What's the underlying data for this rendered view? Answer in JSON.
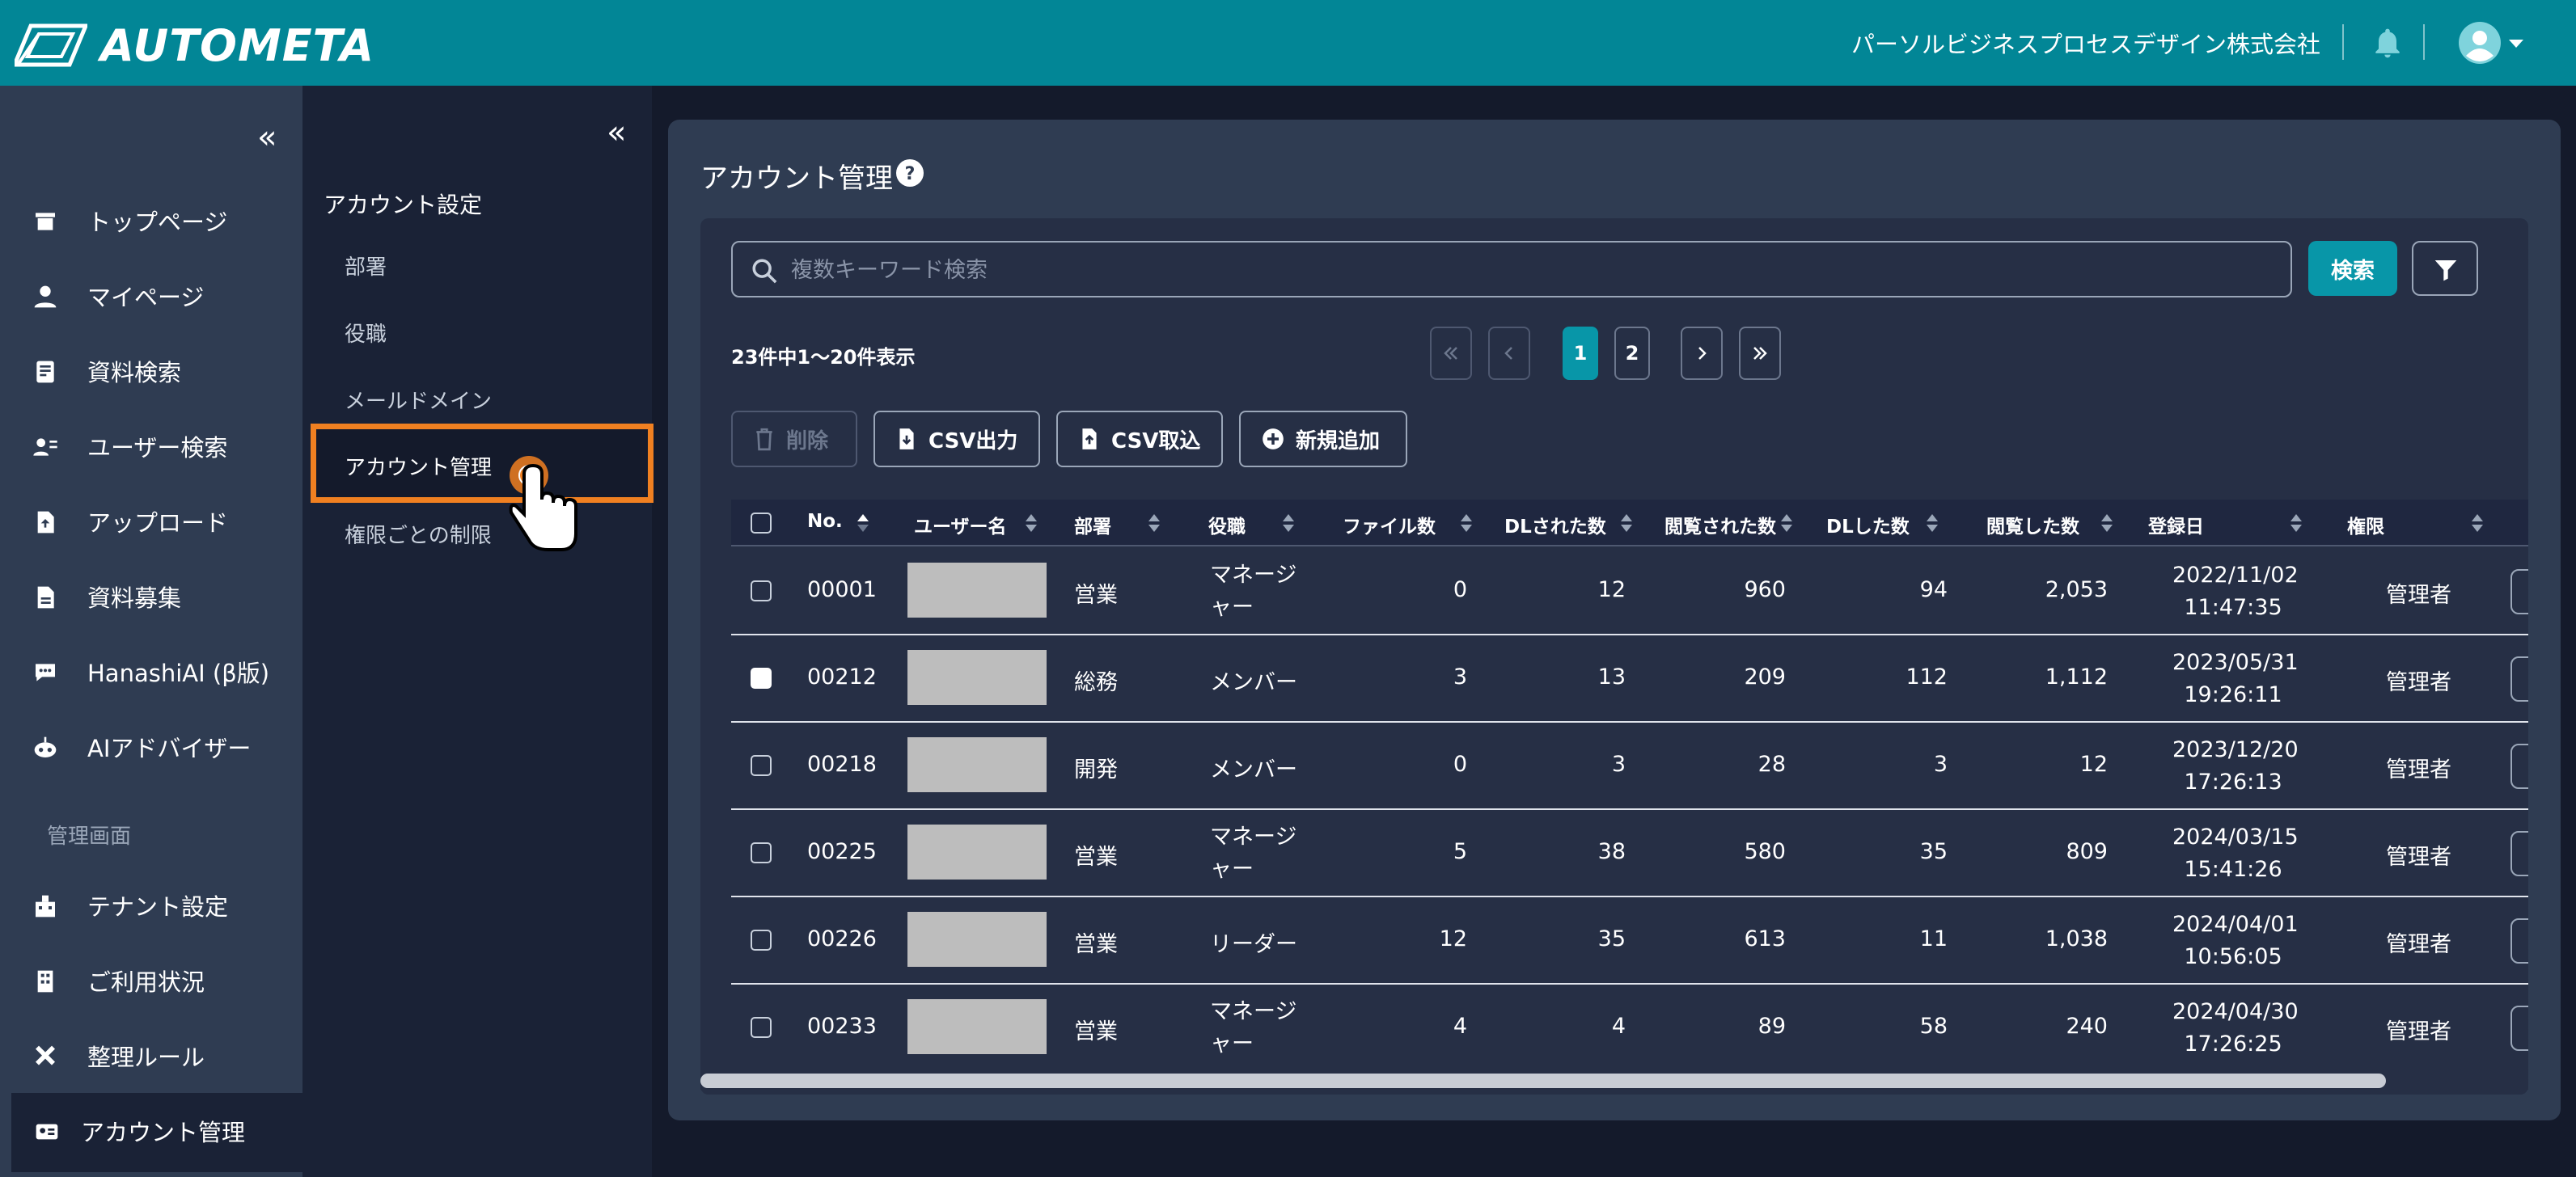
{
  "header": {
    "brand": "AUTOMETA",
    "company": "パーソルビジネスプロセスデザイン株式会社"
  },
  "sidebar": {
    "items": [
      {
        "label": "トップページ",
        "icon": "store-icon"
      },
      {
        "label": "マイページ",
        "icon": "person-icon"
      },
      {
        "label": "資料検索",
        "icon": "document-search-icon"
      },
      {
        "label": "ユーザー検索",
        "icon": "user-search-icon"
      },
      {
        "label": "アップロード",
        "icon": "upload-file-icon"
      },
      {
        "label": "資料募集",
        "icon": "file-icon"
      },
      {
        "label": "HanashiAI (β版)",
        "icon": "chat-icon"
      },
      {
        "label": "AIアドバイザー",
        "icon": "robot-icon"
      }
    ],
    "section_label": "管理画面",
    "admin_items": [
      {
        "label": "テナント設定",
        "icon": "building-icon"
      },
      {
        "label": "ご利用状況",
        "icon": "office-icon"
      },
      {
        "label": "整理ルール",
        "icon": "tools-icon"
      },
      {
        "label": "アカウント管理",
        "icon": "id-card-icon"
      }
    ]
  },
  "subnav": {
    "title": "アカウント設定",
    "items": [
      "部署",
      "役職",
      "メールドメイン",
      "アカウント管理",
      "権限ごとの制限"
    ],
    "active_index": 3
  },
  "main": {
    "title": "アカウント管理",
    "search_placeholder": "複数キーワード検索",
    "search_button": "検索",
    "count_text": "23件中1〜20件表示",
    "pagination": {
      "pages": [
        "1",
        "2"
      ],
      "current": "1"
    },
    "actions": {
      "delete": "削除",
      "csv_export": "CSV出力",
      "csv_import": "CSV取込",
      "add_new": "新規追加"
    },
    "table": {
      "headers": [
        "No.",
        "ユーザー名",
        "部署",
        "役職",
        "ファイル数",
        "DLされた数",
        "閲覧された数",
        "DLした数",
        "閲覧した数",
        "登録日",
        "権限"
      ],
      "rows": [
        {
          "no": "00001",
          "dept": "営業",
          "role1": "マネージ",
          "role2": "ャー",
          "files": "0",
          "dl_recv": "12",
          "view_recv": "960",
          "dl_done": "94",
          "view_done": "2,053",
          "date": "2022/11/02",
          "time": "11:47:35",
          "perm": "管理者",
          "checked": false
        },
        {
          "no": "00212",
          "dept": "総務",
          "role1": "メンバー",
          "role2": "",
          "files": "3",
          "dl_recv": "13",
          "view_recv": "209",
          "dl_done": "112",
          "view_done": "1,112",
          "date": "2023/05/31",
          "time": "19:26:11",
          "perm": "管理者",
          "checked": true
        },
        {
          "no": "00218",
          "dept": "開発",
          "role1": "メンバー",
          "role2": "",
          "files": "0",
          "dl_recv": "3",
          "view_recv": "28",
          "dl_done": "3",
          "view_done": "12",
          "date": "2023/12/20",
          "time": "17:26:13",
          "perm": "管理者",
          "checked": false
        },
        {
          "no": "00225",
          "dept": "営業",
          "role1": "マネージ",
          "role2": "ャー",
          "files": "5",
          "dl_recv": "38",
          "view_recv": "580",
          "dl_done": "35",
          "view_done": "809",
          "date": "2024/03/15",
          "time": "15:41:26",
          "perm": "管理者",
          "checked": false
        },
        {
          "no": "00226",
          "dept": "営業",
          "role1": "リーダー",
          "role2": "",
          "files": "12",
          "dl_recv": "35",
          "view_recv": "613",
          "dl_done": "11",
          "view_done": "1,038",
          "date": "2024/04/01",
          "time": "10:56:05",
          "perm": "管理者",
          "checked": false
        },
        {
          "no": "00233",
          "dept": "営業",
          "role1": "マネージ",
          "role2": "ャー",
          "files": "4",
          "dl_recv": "4",
          "view_recv": "89",
          "dl_done": "58",
          "view_done": "240",
          "date": "2024/04/30",
          "time": "17:26:25",
          "perm": "管理者",
          "checked": false
        }
      ]
    }
  },
  "colors": {
    "header": "#028696",
    "sidebar": "#2f3c52",
    "accent": "#0896a8",
    "highlight": "#f08021"
  }
}
